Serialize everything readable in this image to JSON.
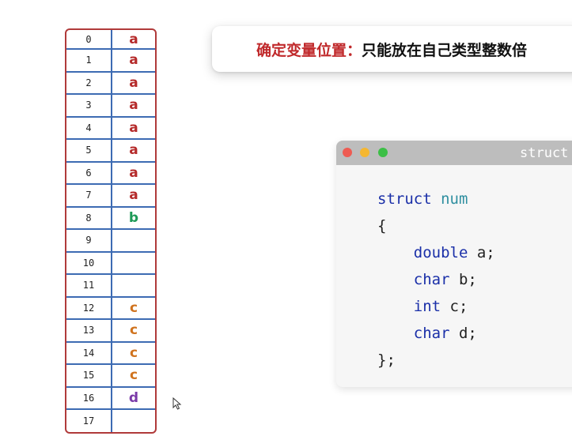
{
  "banner": {
    "key": "确定变量位置：",
    "rest": "只能放在自己类型整数倍"
  },
  "memory": {
    "rows": [
      {
        "index": "0",
        "var": "a"
      },
      {
        "index": "1",
        "var": "a"
      },
      {
        "index": "2",
        "var": "a"
      },
      {
        "index": "3",
        "var": "a"
      },
      {
        "index": "4",
        "var": "a"
      },
      {
        "index": "5",
        "var": "a"
      },
      {
        "index": "6",
        "var": "a"
      },
      {
        "index": "7",
        "var": "a"
      },
      {
        "index": "8",
        "var": "b"
      },
      {
        "index": "9",
        "var": ""
      },
      {
        "index": "10",
        "var": ""
      },
      {
        "index": "11",
        "var": ""
      },
      {
        "index": "12",
        "var": "c"
      },
      {
        "index": "13",
        "var": "c"
      },
      {
        "index": "14",
        "var": "c"
      },
      {
        "index": "15",
        "var": "c"
      },
      {
        "index": "16",
        "var": "d"
      },
      {
        "index": "17",
        "var": ""
      }
    ],
    "var_colors": {
      "a": "#b52a2a",
      "b": "#1e9a57",
      "c": "#d0731e",
      "d": "#7a3aa8"
    }
  },
  "code_window": {
    "title": "struct",
    "lines": {
      "l1_kw": "struct",
      "l1_name": "num",
      "l2": "{",
      "l3_kw": "double",
      "l3_rest": " a;",
      "l4_kw": "char",
      "l4_rest": " b;",
      "l5_kw": "int",
      "l5_rest": " c;",
      "l6_kw": "char",
      "l6_rest": " d;",
      "l7": "};"
    }
  }
}
